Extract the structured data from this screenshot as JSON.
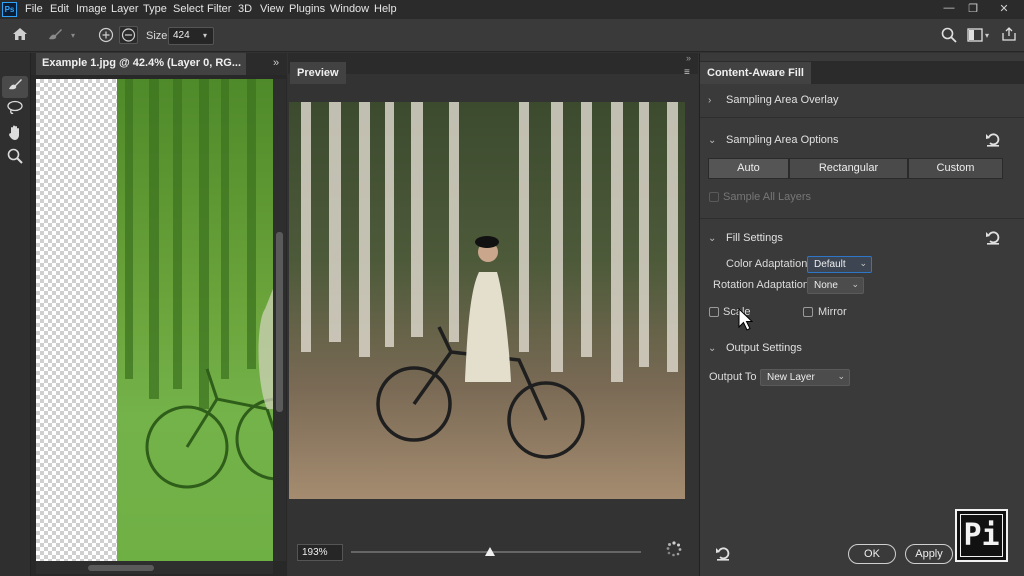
{
  "app": {
    "logo": "Ps"
  },
  "menu": [
    "File",
    "Edit",
    "Image",
    "Layer",
    "Type",
    "Select",
    "Filter",
    "3D",
    "View",
    "Plugins",
    "Window",
    "Help"
  ],
  "window_controls": {
    "minimize": "—",
    "restore": "❐",
    "close": "✕"
  },
  "options_bar": {
    "size_label": "Size",
    "size_value": "424"
  },
  "document": {
    "tab_title": "Example 1.jpg @ 42.4% (Layer 0, RG..."
  },
  "preview": {
    "title": "Preview",
    "zoom": "193%",
    "zoom_level": 0.48
  },
  "caf": {
    "title": "Content-Aware Fill",
    "sampling_overlay": "Sampling Area Overlay",
    "sampling_options": "Sampling Area Options",
    "modes": [
      "Auto",
      "Rectangular",
      "Custom"
    ],
    "selected_mode": "Auto",
    "sample_all_layers": "Sample All Layers",
    "fill_settings": "Fill Settings",
    "color_adaptation_label": "Color Adaptation",
    "color_adaptation_value": "Default",
    "rotation_adaptation_label": "Rotation Adaptation",
    "rotation_adaptation_value": "None",
    "scale_label": "Scale",
    "mirror_label": "Mirror",
    "output_settings": "Output Settings",
    "output_to_label": "Output To",
    "output_to_value": "New Layer",
    "ok_label": "OK",
    "apply_label": "Apply"
  },
  "watermark": "Pi",
  "icons": {
    "home": "home-icon",
    "brush": "brush-icon",
    "lasso": "lasso-icon",
    "hand": "hand-icon",
    "zoom": "zoom-icon",
    "search": "search-icon",
    "share": "share-icon"
  }
}
